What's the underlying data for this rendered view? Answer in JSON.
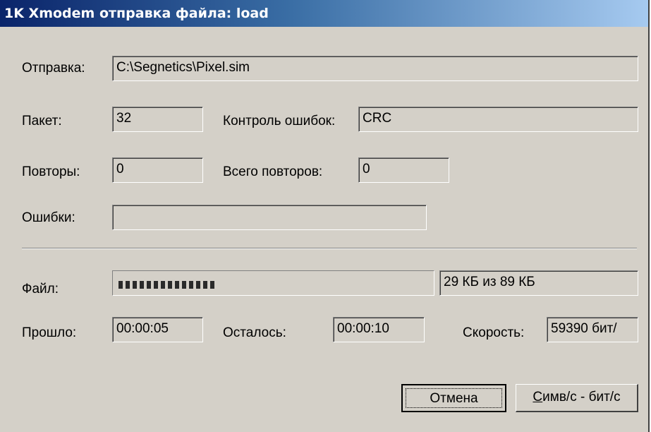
{
  "window": {
    "title": "1K Xmodem отправка файла: load"
  },
  "labels": {
    "sending": "Отправка:",
    "packet": "Пакет:",
    "error_control": "Контроль ошибок:",
    "retries": "Повторы:",
    "total_retries": "Всего повторов:",
    "errors": "Ошибки:",
    "file": "Файл:",
    "elapsed": "Прошло:",
    "remaining": "Осталось:",
    "speed": "Скорость:"
  },
  "values": {
    "sending_path": "C:\\Segnetics\\Pixel.sim",
    "packet": "32",
    "error_control": "CRC",
    "retries": "0",
    "total_retries": "0",
    "errors": "",
    "file_progress_text": "29 КБ из 89 КБ",
    "file_progress_fraction": 0.326,
    "elapsed": "00:00:05",
    "remaining": "00:00:10",
    "speed": "59390 бит/"
  },
  "buttons": {
    "cancel": "Отмена",
    "toggle_units_hotkey": "С",
    "toggle_units_rest": "имв/с - бит/с"
  },
  "colors": {
    "face": "#d4d0c8",
    "title_start": "#0a246a",
    "title_end": "#a6caf0",
    "progress_block": "#2a2a2a"
  }
}
